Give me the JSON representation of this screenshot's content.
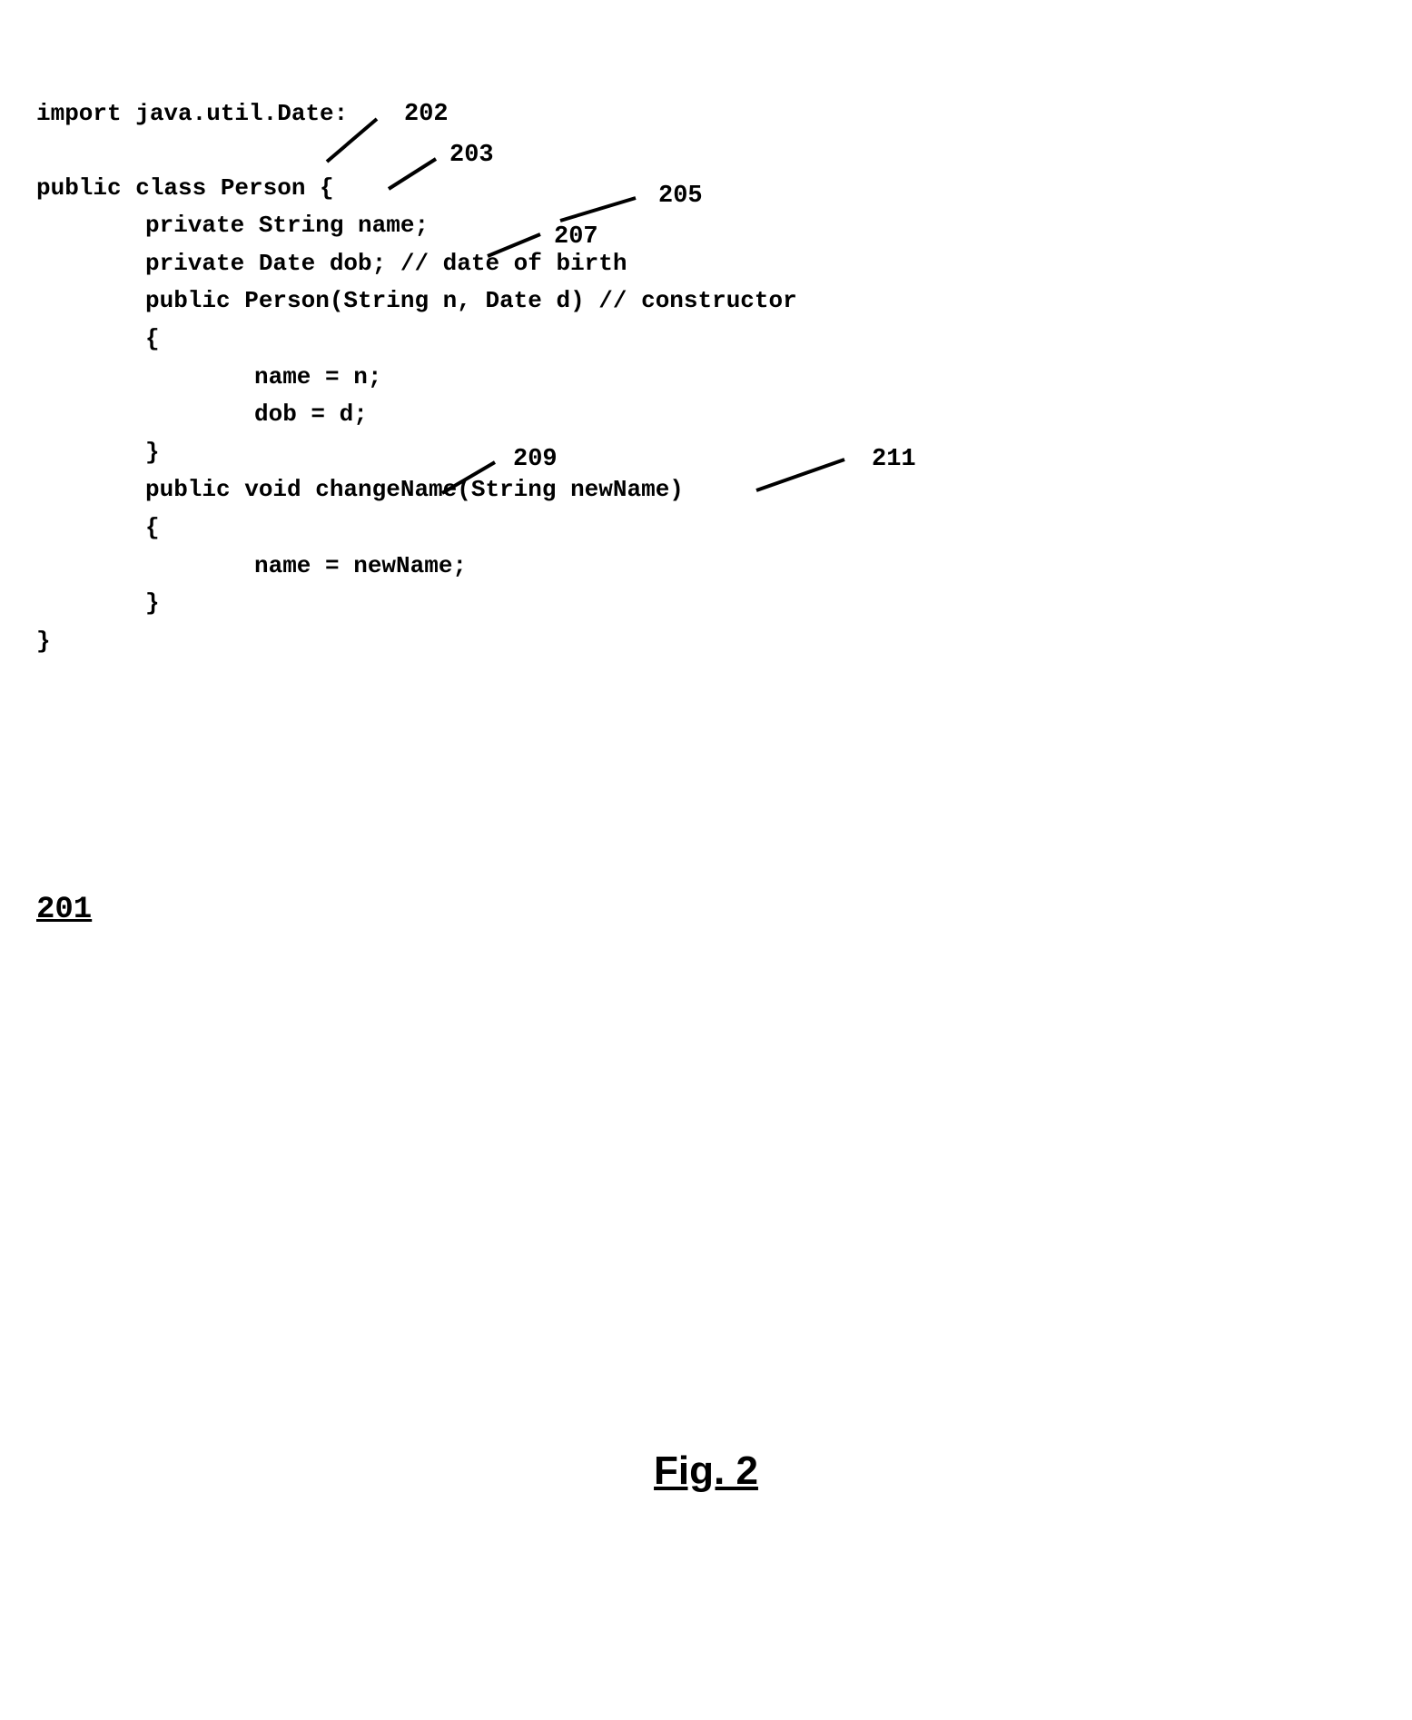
{
  "refs": {
    "r202": "202",
    "r203": "203",
    "r205": "205",
    "r207": "207",
    "r209": "209",
    "r211": "211",
    "r201": "201"
  },
  "figure_caption": "Fig. 2",
  "code": {
    "l1": "import java.util.Date:",
    "l2": "public class Person {",
    "l3": "private String name;",
    "l4": "private Date dob; // date of birth",
    "l5": "public Person(String n, Date d) // constructor",
    "l6": "{",
    "l7": "name = n;",
    "l8": "dob = d;",
    "l9": "}",
    "l10": "public void changeName(String newName)",
    "l11": "{",
    "l12": "name = newName;",
    "l13": "}",
    "l14": "}"
  }
}
